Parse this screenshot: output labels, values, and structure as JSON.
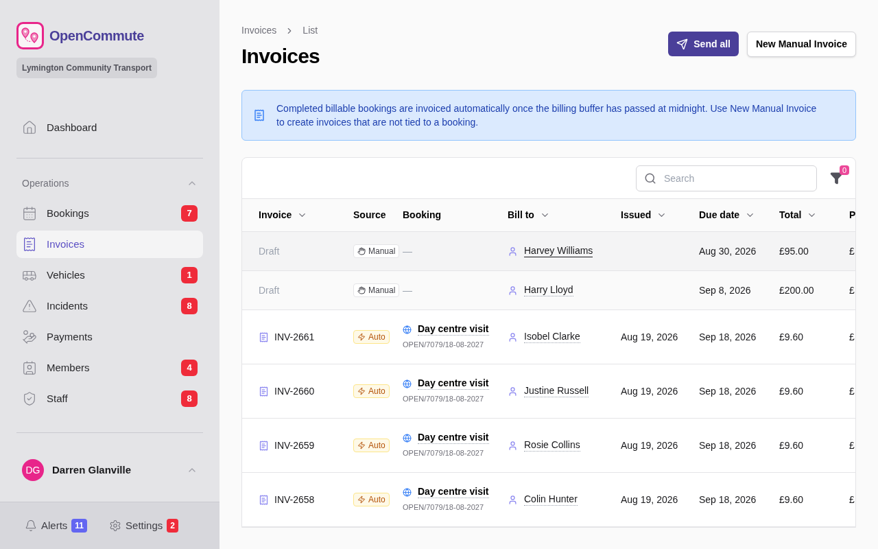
{
  "brand": {
    "name": "OpenCommute",
    "org": "Lymington Community Transport"
  },
  "nav_top": [
    {
      "label": "Dashboard",
      "selected": false
    }
  ],
  "section": {
    "label": "Operations",
    "expanded": true
  },
  "nav": [
    {
      "label": "Bookings",
      "badge": "7",
      "selected": false
    },
    {
      "label": "Invoices",
      "selected": true
    },
    {
      "label": "Vehicles",
      "badge": "1",
      "selected": false
    },
    {
      "label": "Incidents",
      "badge": "8",
      "selected": false
    },
    {
      "label": "Payments",
      "selected": false
    },
    {
      "label": "Members",
      "badge": "4",
      "selected": false
    },
    {
      "label": "Staff",
      "badge": "8",
      "selected": false
    }
  ],
  "user": {
    "initials": "DG",
    "name": "Darren Glanville"
  },
  "footer": [
    {
      "label": "Alerts",
      "badge": "11",
      "color": "#6366f1"
    },
    {
      "label": "Settings",
      "badge": "2",
      "color": "#ef2b3a"
    }
  ],
  "breadcrumb": [
    "Invoices",
    "List"
  ],
  "title": "Invoices",
  "actions": {
    "primary": "Send all",
    "secondary": "New Manual Invoice"
  },
  "notice": "Completed billable bookings are invoiced automatically once the billing buffer has passed at midnight. Use New Manual Invoice to create invoices that are not tied to a booking.",
  "search": {
    "placeholder": "Search"
  },
  "filter_count": "0",
  "columns": [
    {
      "label": "Invoice",
      "sortable": true
    },
    {
      "label": "Source",
      "sortable": false
    },
    {
      "label": "Booking",
      "sortable": false
    },
    {
      "label": "Bill to",
      "sortable": true
    },
    {
      "label": "Issued",
      "sortable": true
    },
    {
      "label": "Due date",
      "sortable": true
    },
    {
      "label": "Total",
      "sortable": true
    },
    {
      "label": "P",
      "sortable": false
    }
  ],
  "rows": [
    {
      "kind": "draft",
      "selected": true,
      "invoice": "Draft",
      "source": {
        "kind": "manual",
        "label": "Manual"
      },
      "booking": {
        "kind": "none",
        "text": "—"
      },
      "bill_to": "Harvey Williams",
      "due": "Aug 30, 2026",
      "total": "£95.00",
      "column_8": "£"
    },
    {
      "kind": "draft",
      "selected": false,
      "invoice": "Draft",
      "source": {
        "kind": "manual",
        "label": "Manual"
      },
      "booking": {
        "kind": "none",
        "text": "—"
      },
      "bill_to": "Harry Lloyd",
      "due": "Sep 8, 2026",
      "total": "£200.00",
      "column_8": "£"
    },
    {
      "kind": "invoice",
      "selected": false,
      "invoice": "INV-2661",
      "source": {
        "kind": "auto",
        "label": "Auto"
      },
      "booking": {
        "kind": "trip",
        "title": "Day centre visit",
        "ref": "OPEN/7079/18-08-2027"
      },
      "bill_to": "Isobel Clarke",
      "issued": "Aug 19, 2026",
      "due": "Sep 18, 2026",
      "total": "£9.60",
      "column_8": "£"
    },
    {
      "kind": "invoice",
      "selected": false,
      "invoice": "INV-2660",
      "source": {
        "kind": "auto",
        "label": "Auto"
      },
      "booking": {
        "kind": "trip",
        "title": "Day centre visit",
        "ref": "OPEN/7079/18-08-2027"
      },
      "bill_to": "Justine Russell",
      "issued": "Aug 19, 2026",
      "due": "Sep 18, 2026",
      "total": "£9.60",
      "column_8": "£"
    },
    {
      "kind": "invoice",
      "selected": false,
      "invoice": "INV-2659",
      "source": {
        "kind": "auto",
        "label": "Auto"
      },
      "booking": {
        "kind": "trip",
        "title": "Day centre visit",
        "ref": "OPEN/7079/18-08-2027"
      },
      "bill_to": "Rosie Collins",
      "issued": "Aug 19, 2026",
      "due": "Sep 18, 2026",
      "total": "£9.60",
      "column_8": "£"
    },
    {
      "kind": "invoice",
      "selected": false,
      "invoice": "INV-2658",
      "source": {
        "kind": "auto",
        "label": "Auto"
      },
      "booking": {
        "kind": "trip",
        "title": "Day centre visit",
        "ref": "OPEN/7079/18-08-2027"
      },
      "bill_to": "Colin Hunter",
      "issued": "Aug 19, 2026",
      "due": "Sep 18, 2026",
      "total": "£9.60",
      "column_8": "£"
    }
  ]
}
